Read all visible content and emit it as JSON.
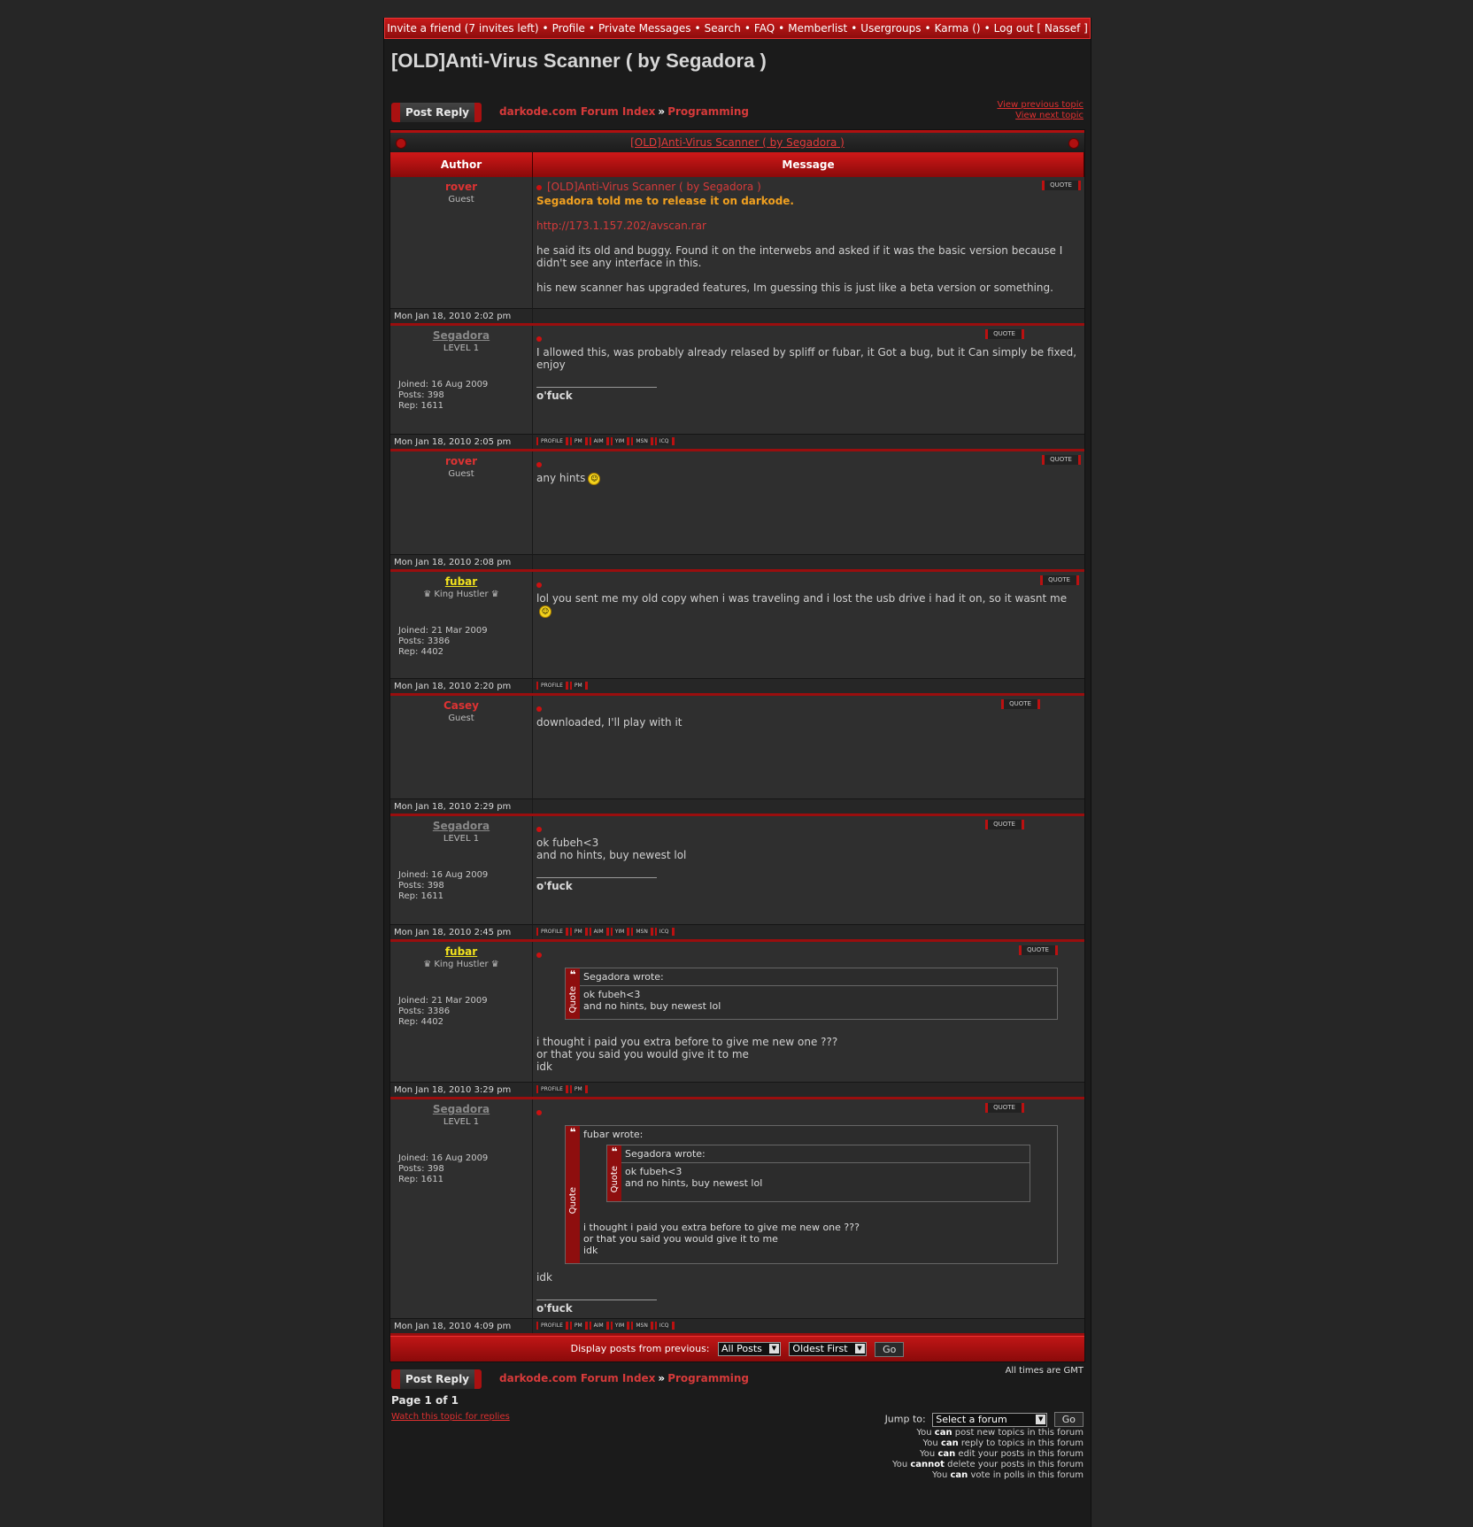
{
  "topnav": {
    "items": [
      "Invite a friend (7 invites left)",
      "Profile",
      "Private Messages",
      "Search",
      "FAQ",
      "Memberlist",
      "Usergroups",
      "Karma ()",
      "Log out [ Nassef ]"
    ]
  },
  "topic_title": "[OLD]Anti-Virus Scanner ( by Segadora )",
  "nav": {
    "post_reply": "Post Reply",
    "forum_index": "darkode.com Forum Index",
    "crumb_sep": "»",
    "forum": "Programming",
    "prev_topic": "View previous topic",
    "next_topic": "View next topic"
  },
  "table": {
    "panel_title": "[OLD]Anti-Virus Scanner ( by Segadora )",
    "author_header": "Author",
    "message_header": "Message",
    "quote_label": "QUOTE",
    "profile_label": "PROFILE",
    "pm_label": "PM",
    "aim_label": "AIM",
    "yim_label": "YIM",
    "msn_label": "MSN",
    "icq_label": "ICQ",
    "wrote_suffix": " wrote:",
    "quote_word": "Quote",
    "joined_prefix": "Joined: ",
    "posts_prefix": "Posts: ",
    "rep_prefix": "Rep: "
  },
  "posts": [
    {
      "author": "rover",
      "rank": "Guest",
      "subject": "[OLD]Anti-Virus Scanner ( by Segadora )",
      "line1": "Segadora told me to release it on darkode.",
      "link": "http://173.1.157.202/avscan.rar",
      "line2": "he said its old and buggy. Found it on the interwebs and asked if it was the basic version because I didn't see any interface in this.",
      "line3": "his new scanner has upgraded features, Im guessing this is just like a beta version or something.",
      "date": "Mon Jan 18, 2010 2:02 pm"
    },
    {
      "author": "Segadora",
      "rank": "LEVEL 1",
      "joined": "16 Aug 2009",
      "posts": "398",
      "rep": "1611",
      "text": "I allowed this, was probably already relased by spliff or fubar, it Got a bug, but it Can simply be fixed, enjoy",
      "sig": "o'fuck",
      "date": "Mon Jan 18, 2010 2:05 pm"
    },
    {
      "author": "rover",
      "rank": "Guest",
      "text": "any hints",
      "date": "Mon Jan 18, 2010 2:08 pm"
    },
    {
      "author": "fubar",
      "rank": "♛ King Hustler ♛",
      "joined": "21 Mar 2009",
      "posts": "3386",
      "rep": "4402",
      "text": "lol you sent me my old copy when i was traveling and i lost the usb drive i had it on, so it wasnt me",
      "date": "Mon Jan 18, 2010 2:20 pm"
    },
    {
      "author": "Casey",
      "rank": "Guest",
      "text": "downloaded, I'll play with it",
      "date": "Mon Jan 18, 2010 2:29 pm"
    },
    {
      "author": "Segadora",
      "rank": "LEVEL 1",
      "joined": "16 Aug 2009",
      "posts": "398",
      "rep": "1611",
      "line1": "ok fubeh<3",
      "line2": "and no hints, buy newest lol",
      "sig": "o'fuck",
      "date": "Mon Jan 18, 2010 2:45 pm"
    },
    {
      "author": "fubar",
      "rank": "♛ King Hustler ♛",
      "joined": "21 Mar 2009",
      "posts": "3386",
      "rep": "4402",
      "quote_author": "Segadora",
      "quote_line1": "ok fubeh<3",
      "quote_line2": "and no hints, buy newest lol",
      "line1": "i thought i paid you extra before to give me new one ???",
      "line2": "or that you said you would give it to me",
      "line3": "idk",
      "date": "Mon Jan 18, 2010 3:29 pm"
    },
    {
      "author": "Segadora",
      "rank": "LEVEL 1",
      "joined": "16 Aug 2009",
      "posts": "398",
      "rep": "1611",
      "outer_quote_author": "fubar",
      "inner_quote_author": "Segadora",
      "inner_line1": "ok fubeh<3",
      "inner_line2": "and no hints, buy newest lol",
      "outer_line1": "i thought i paid you extra before to give me new one ???",
      "outer_line2": "or that you said you would give it to me",
      "outer_line3": "idk",
      "text": "idk",
      "sig": "o'fuck",
      "date": "Mon Jan 18, 2010 4:09 pm"
    }
  ],
  "display": {
    "label": "Display posts from previous:",
    "posts_select": "All Posts",
    "order_select": "Oldest First",
    "go": "Go"
  },
  "bottom": {
    "times": "All times are GMT",
    "page": "Page 1 of 1",
    "watch": "Watch this topic for replies",
    "jump_label": "Jump to:",
    "jump_select": "Select a forum",
    "go": "Go",
    "perms": [
      {
        "pre": "You ",
        "b": "can",
        "post": " post new topics in this forum"
      },
      {
        "pre": "You ",
        "b": "can",
        "post": " reply to topics in this forum"
      },
      {
        "pre": "You ",
        "b": "can",
        "post": " edit your posts in this forum"
      },
      {
        "pre": "You ",
        "b": "cannot",
        "post": " delete your posts in this forum"
      },
      {
        "pre": "You ",
        "b": "can",
        "post": " vote in polls in this forum"
      }
    ]
  }
}
